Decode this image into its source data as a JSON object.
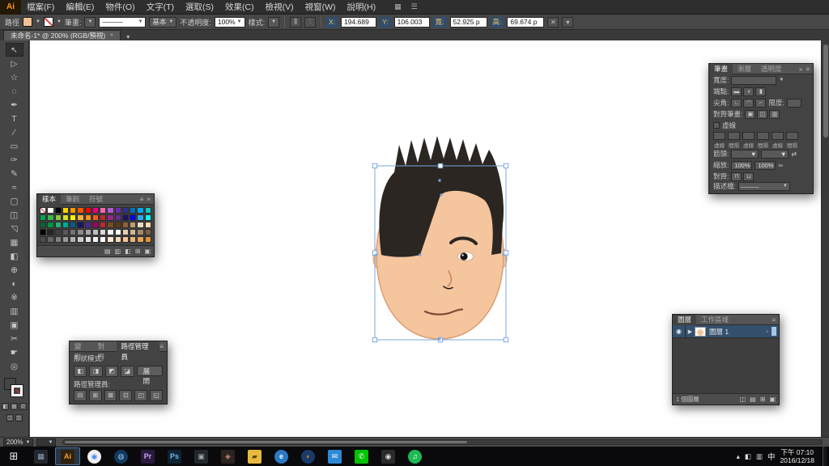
{
  "app": {
    "logo": "Ai"
  },
  "menu": {
    "items": [
      "檔案(F)",
      "編輯(E)",
      "物件(O)",
      "文字(T)",
      "選取(S)",
      "效果(C)",
      "檢視(V)",
      "視窗(W)",
      "說明(H)"
    ],
    "extra_icons": [
      "▦",
      "☰"
    ]
  },
  "control_bar": {
    "selection_label": "路徑",
    "stroke_label": "筆畫:",
    "profile_value": "———",
    "brush_value": "基本",
    "opacity_label": "不透明度:",
    "opacity_value": "100%",
    "style_label": "樣式:",
    "fields": [
      {
        "label": "X:",
        "value": "194.689"
      },
      {
        "label": "Y:",
        "value": "106.003"
      },
      {
        "label": "寬:",
        "value": "52.925 p"
      },
      {
        "label": "高:",
        "value": "69.674 p"
      }
    ]
  },
  "doc_tab": {
    "title": "未命名-1* @ 200% (RGB/預視)"
  },
  "active_tool": 0,
  "tools": [
    {
      "name": "selection",
      "glyph": "↖"
    },
    {
      "name": "direct-selection",
      "glyph": "▷"
    },
    {
      "name": "magic-wand",
      "glyph": "☆"
    },
    {
      "name": "lasso",
      "glyph": "◌"
    },
    {
      "name": "pen",
      "glyph": "✒"
    },
    {
      "name": "type",
      "glyph": "T"
    },
    {
      "name": "line-segment",
      "glyph": "∕"
    },
    {
      "name": "rectangle",
      "glyph": "▭"
    },
    {
      "name": "paintbrush",
      "glyph": "✑"
    },
    {
      "name": "pencil",
      "glyph": "✎"
    },
    {
      "name": "width",
      "glyph": "≈"
    },
    {
      "name": "free-transform",
      "glyph": "▢"
    },
    {
      "name": "shape-builder",
      "glyph": "◫"
    },
    {
      "name": "perspective-grid",
      "glyph": "◹"
    },
    {
      "name": "mesh",
      "glyph": "▦"
    },
    {
      "name": "gradient",
      "glyph": "◧"
    },
    {
      "name": "eyedropper",
      "glyph": "⊕"
    },
    {
      "name": "blend",
      "glyph": "◐"
    },
    {
      "name": "symbol-sprayer",
      "glyph": "※"
    },
    {
      "name": "column-graph",
      "glyph": "▥"
    },
    {
      "name": "artboard",
      "glyph": "▣"
    },
    {
      "name": "slice",
      "glyph": "✂"
    },
    {
      "name": "hand",
      "glyph": "☛"
    },
    {
      "name": "zoom",
      "glyph": "◎"
    }
  ],
  "toolbar_fill_color": "#f2c193",
  "swatches_panel": {
    "tabs": [
      "樣本",
      "筆刷",
      "符號"
    ],
    "footer_icons": [
      "▤",
      "▥",
      "◧",
      "⊞",
      "▣"
    ],
    "rows": [
      [
        "none",
        "#ffffff",
        "#000000",
        "#ffd400",
        "#ff9900",
        "#ff5400",
        "#ff0000",
        "#e6007e",
        "#ff66b3",
        "#b05bd6",
        "#6f2da8",
        "#2e3192",
        "#0071bc",
        "#00a8e8",
        "#00c9c9"
      ],
      [
        "#00a651",
        "#39b54a",
        "#8dc63f",
        "#d9e021",
        "#fff200",
        "#fbb03b",
        "#f7931e",
        "#f15a24",
        "#c1272d",
        "#93278f",
        "#662d91",
        "#1b1464",
        "#0000ff",
        "#29abe2",
        "#00ffff"
      ],
      [
        "#006837",
        "#009245",
        "#22b573",
        "#00a99d",
        "#005f87",
        "#1b1464",
        "#4d2b8c",
        "#9e005d",
        "#c1272d",
        "#754c24",
        "#603813",
        "#8c6239",
        "#c69c6d",
        "#e8d9c4",
        "#ffdda9"
      ],
      [
        "#000000",
        "#262626",
        "#404040",
        "#595959",
        "#737373",
        "#8c8c8c",
        "#a6a6a6",
        "#bfbfbf",
        "#d9d9d9",
        "#f2f2f2",
        "#ffffff",
        "#e8d0b0",
        "#cbb698",
        "#a58a66",
        "#7c623f"
      ],
      [
        "#4d4d4d",
        "#666666",
        "#808080",
        "#999999",
        "#b3b3b3",
        "#cccccc",
        "#e6e6e6",
        "#f2f2f2",
        "#ffffff",
        "#fce8d5",
        "#f7d7b5",
        "#f2c696",
        "#ecb576",
        "#e6a456",
        "#e09337"
      ]
    ]
  },
  "pathfinder_panel": {
    "tabs": [
      "變形",
      "對齊",
      "路徑管理員"
    ],
    "shape_mode_label": "形狀模式:",
    "expand_button": "展開",
    "pathfinder_label": "路徑管理員:",
    "shape_icons": [
      "◧",
      "◨",
      "◩",
      "◪"
    ],
    "pf_icons": [
      "⊟",
      "⊞",
      "⊠",
      "⊡",
      "◰",
      "◱"
    ]
  },
  "layers_panel": {
    "tabs": [
      "圖層",
      "工作區域"
    ],
    "layer_name": "圖層 1",
    "status": "1 個圖層",
    "footer_icons": [
      "◫",
      "▤",
      "⊞",
      "▣"
    ]
  },
  "stroke_panel": {
    "tabs": [
      "筆畫",
      "漸層",
      "透明度"
    ],
    "width_label": "寬度:",
    "cap_label": "端點:",
    "cap_icons": [
      "▬",
      "◖",
      "▮"
    ],
    "corner_label": "尖角:",
    "corner_icons": [
      "∟",
      "◠",
      "⌐"
    ],
    "limit_label": "限度:",
    "align_stroke_label": "對齊筆畫:",
    "align_stroke_icons": [
      "▣",
      "◫",
      "▥"
    ],
    "dash_label": "虛線",
    "dash_fields": [
      "虛線",
      "間隔",
      "虛線",
      "間隔",
      "虛線",
      "間隔"
    ],
    "arrow_label": "箭頭:",
    "swap_icon": "⇄",
    "scale_label": "縮放:",
    "scale_values": [
      "100%",
      "100%"
    ],
    "link_icon": "∞",
    "align_label": "對齊:",
    "align_icons": [
      "⊓",
      "⊔"
    ],
    "profile_label": "描述檔:",
    "profile_value": "———"
  },
  "status_bar": {
    "zoom": "200%"
  },
  "artwork": {
    "selection_color": "#7aa7e0",
    "skin": "#f5c59e",
    "skin_stroke": "#dd9d72",
    "hair": "#2b2621",
    "eye_dark": "#17120e",
    "mouth": "#7d4b36",
    "nose": "#c8865c"
  },
  "taskbar": {
    "start_glyph": "⊞",
    "icons": [
      {
        "name": "taskbar-app-generic",
        "glyph": "▦",
        "fg": "#8fa3b8",
        "bg": "#23282e",
        "shape": "square"
      },
      {
        "name": "taskbar-illustrator",
        "glyph": "Ai",
        "fg": "#f0a030",
        "bg": "#30210e",
        "shape": "square",
        "active": true
      },
      {
        "name": "taskbar-chrome",
        "glyph": "◉",
        "fg": "#4285f4",
        "bg": "#f1f1f1",
        "shape": "circle"
      },
      {
        "name": "taskbar-app-blue-sphere",
        "glyph": "◍",
        "fg": "#9cc4e8",
        "bg": "#123a5e",
        "shape": "circle"
      },
      {
        "name": "taskbar-premiere",
        "glyph": "Pr",
        "fg": "#c9a3f5",
        "bg": "#2a1a3e",
        "shape": "square"
      },
      {
        "name": "taskbar-photoshop",
        "glyph": "Ps",
        "fg": "#7ab8e8",
        "bg": "#0e2334",
        "shape": "square"
      },
      {
        "name": "taskbar-app-dark-1",
        "glyph": "▣",
        "fg": "#99a4aa",
        "bg": "#23272b",
        "shape": "square"
      },
      {
        "name": "taskbar-app-dark-2",
        "glyph": "◈",
        "fg": "#cc8866",
        "bg": "#2b2320",
        "shape": "square"
      },
      {
        "name": "taskbar-file-explorer",
        "glyph": "▰",
        "fg": "#5a4a1a",
        "bg": "#e8b93e",
        "shape": "square"
      },
      {
        "name": "taskbar-ie",
        "glyph": "e",
        "fg": "#ffffff",
        "bg": "#2a79c4",
        "shape": "circle"
      },
      {
        "name": "taskbar-firefox",
        "glyph": "◗",
        "fg": "#ff9500",
        "bg": "#1a3a6b",
        "shape": "circle"
      },
      {
        "name": "taskbar-mail",
        "glyph": "✉",
        "fg": "#ffffff",
        "bg": "#2d89d8",
        "shape": "square"
      },
      {
        "name": "taskbar-line",
        "glyph": "✆",
        "fg": "#ffffff",
        "bg": "#00c300",
        "shape": "square"
      },
      {
        "name": "taskbar-camera",
        "glyph": "◉",
        "fg": "#dddddd",
        "bg": "#2b2b2b",
        "shape": "square"
      },
      {
        "name": "taskbar-spotify",
        "glyph": "♫",
        "fg": "#ffffff",
        "bg": "#1db954",
        "shape": "circle"
      }
    ],
    "tray": {
      "icons": [
        "▴",
        "◧",
        "▥"
      ],
      "ime": "中",
      "time": "下午 07:10",
      "date": "2016/12/18"
    }
  }
}
